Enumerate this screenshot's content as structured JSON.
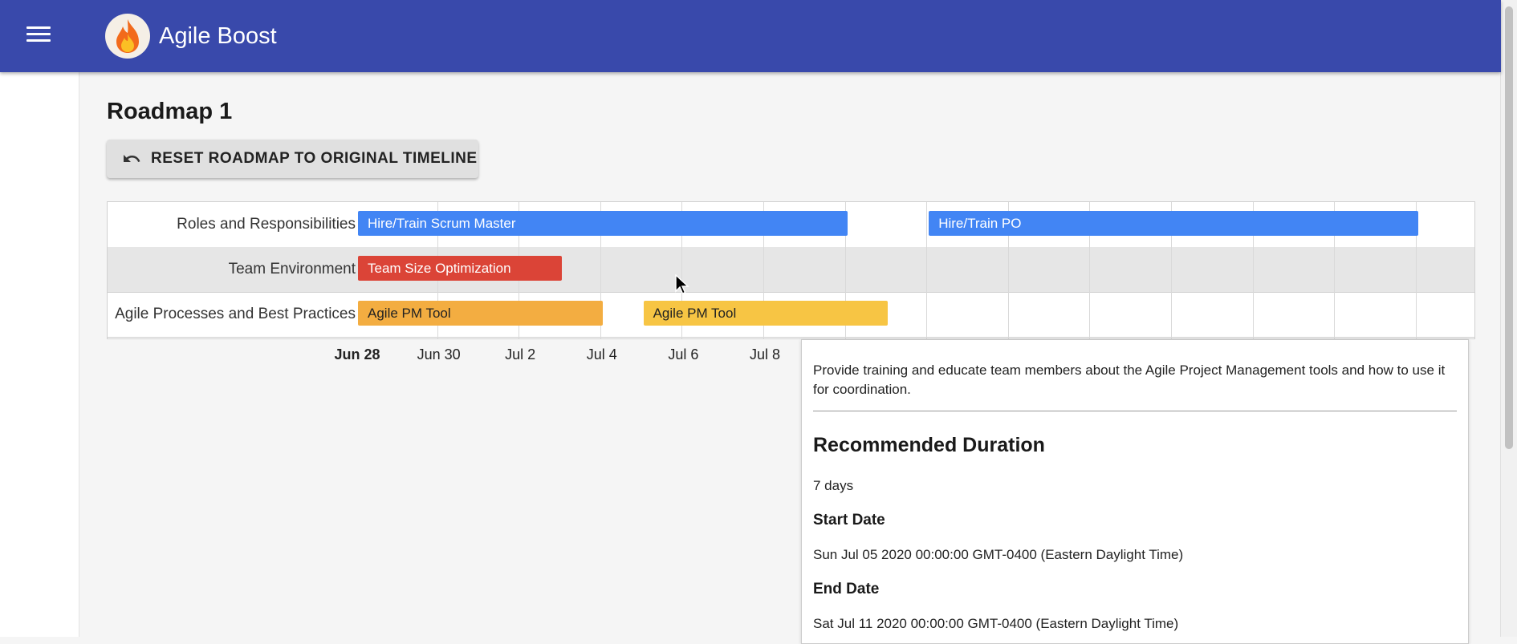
{
  "app": {
    "title": "Agile Boost"
  },
  "page": {
    "title": "Roadmap 1",
    "reset_button": "RESET ROADMAP TO ORIGINAL TIMELINE"
  },
  "roadmap": {
    "rows": [
      {
        "label": "Roles and Responsibilities",
        "shaded": false
      },
      {
        "label": "Team Environment",
        "shaded": true
      },
      {
        "label": "Agile Processes and Best Practices",
        "shaded": false
      }
    ],
    "bars": [
      {
        "row": 0,
        "label": "Hire/Train Scrum Master",
        "start": "2020-06-28",
        "end": "2020-07-10",
        "color": "#4285f4",
        "text_color": "#ffffff"
      },
      {
        "row": 0,
        "label": "Hire/Train PO",
        "start": "2020-07-12",
        "end": "2020-07-24",
        "color": "#4285f4",
        "text_color": "#ffffff"
      },
      {
        "row": 1,
        "label": "Team Size Optimization",
        "start": "2020-06-28",
        "end": "2020-07-03",
        "color": "#db4437",
        "text_color": "#ffffff"
      },
      {
        "row": 2,
        "label": "Agile PM Tool",
        "start": "2020-06-28",
        "end": "2020-07-04",
        "color": "#f3ad41",
        "text_color": "#222222"
      },
      {
        "row": 2,
        "label": "Agile PM Tool",
        "start": "2020-07-05",
        "end": "2020-07-11",
        "color": "#f7c544",
        "text_color": "#222222"
      }
    ],
    "axis_start": "2020-06-28",
    "axis_ticks": [
      {
        "label": "Jun 28",
        "date": "2020-06-28",
        "bold": true
      },
      {
        "label": "Jun 30",
        "date": "2020-06-30",
        "bold": false
      },
      {
        "label": "Jul 2",
        "date": "2020-07-02",
        "bold": false
      },
      {
        "label": "Jul 4",
        "date": "2020-07-04",
        "bold": false
      },
      {
        "label": "Jul 6",
        "date": "2020-07-06",
        "bold": false
      },
      {
        "label": "Jul 8",
        "date": "2020-07-08",
        "bold": false
      }
    ]
  },
  "tooltip": {
    "description": "Provide training and educate team members about the Agile Project Management tools and how to use it for coordination.",
    "duration_heading": "Recommended Duration",
    "duration_value": "7 days",
    "start_heading": "Start Date",
    "start_value": "Sun Jul 05 2020 00:00:00 GMT-0400 (Eastern Daylight Time)",
    "end_heading": "End Date",
    "end_value": "Sat Jul 11 2020 00:00:00 GMT-0400 (Eastern Daylight Time)"
  }
}
